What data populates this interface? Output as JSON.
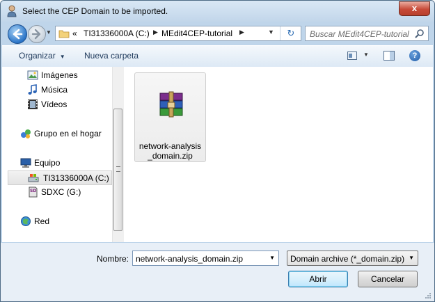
{
  "window": {
    "title": "Select the CEP Domain to be imported.",
    "close_label": "x"
  },
  "address": {
    "overflow": "«",
    "segments": [
      "TI31336000A (C:)",
      "MEdit4CEP-tutorial"
    ],
    "search_placeholder": "Buscar MEdit4CEP-tutorial"
  },
  "toolbar": {
    "organize_label": "Organizar",
    "new_folder_label": "Nueva carpeta",
    "help_label": "?"
  },
  "nav": {
    "items": [
      {
        "label": "Imágenes",
        "icon": "pictures-icon"
      },
      {
        "label": "Música",
        "icon": "music-icon"
      },
      {
        "label": "Vídeos",
        "icon": "videos-icon"
      },
      {
        "label": "Grupo en el hogar",
        "icon": "homegroup-icon"
      },
      {
        "label": "Equipo",
        "icon": "computer-icon"
      },
      {
        "label": "TI31336000A (C:)",
        "icon": "drive-icon",
        "selected": true
      },
      {
        "label": "SDXC (G:)",
        "icon": "sd-card-icon"
      },
      {
        "label": "Red",
        "icon": "network-icon"
      }
    ]
  },
  "files": [
    {
      "name_line1": "network-analysis",
      "name_line2": "_domain.zip",
      "icon": "zip-archive-icon"
    }
  ],
  "bottom": {
    "name_label": "Nombre:",
    "name_value": "network-analysis_domain.zip",
    "type_value": "Domain archive (*_domain.zip)",
    "open_label": "Abrir",
    "cancel_label": "Cancelar"
  },
  "colors": {
    "accent": "#2b75c8",
    "toolbar_text": "#1e395b",
    "close_button": "#c74a38"
  }
}
